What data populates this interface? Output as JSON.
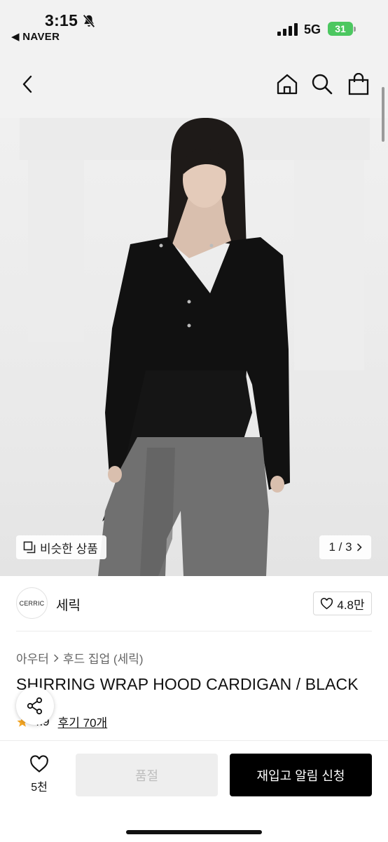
{
  "status_bar": {
    "time": "3:15",
    "back_app": "◀ NAVER",
    "network": "5G",
    "battery": "31"
  },
  "header": {
    "icons": [
      "back-arrow-icon",
      "home-icon",
      "search-icon",
      "shopping-bag-icon"
    ]
  },
  "hero": {
    "similar_label": "비슷한 상품",
    "pager_text": "1 / 3"
  },
  "brand": {
    "logo_text": "CERRIC",
    "name": "세릭",
    "likes": "4.8만"
  },
  "breadcrumb": {
    "category": "아우터",
    "subcategory": "후드 집업 (세릭)"
  },
  "product": {
    "title": "SHIRRING WRAP HOOD CARDIGAN / BLACK",
    "rating": "4.9",
    "reviews": "후기 70개"
  },
  "bottom_bar": {
    "wish_count": "5천",
    "soldout_label": "품절",
    "restock_label": "재입고 알림 신청"
  },
  "colors": {
    "primary": "#000000",
    "battery": "#4cc760",
    "star": "#f5a623"
  }
}
